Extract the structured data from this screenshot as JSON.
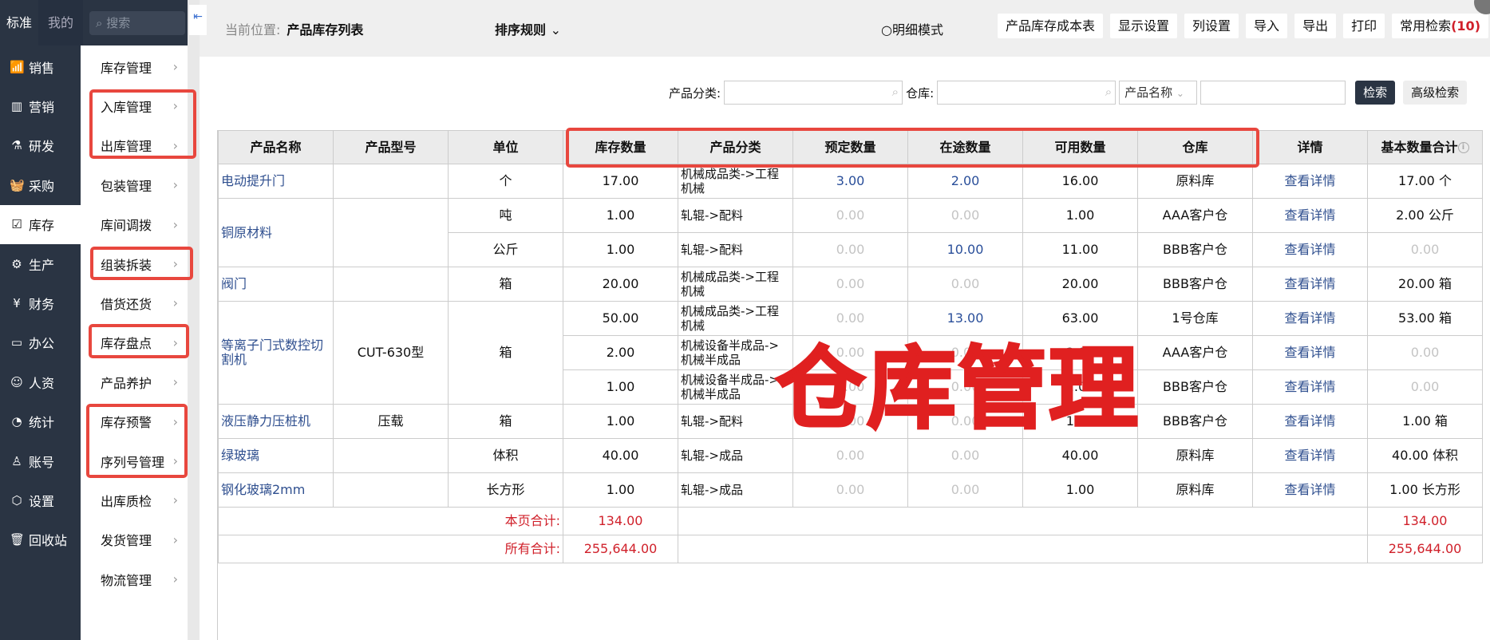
{
  "topnav": {
    "tab_standard": "标准",
    "tab_mine": "我的",
    "search_placeholder": "搜索"
  },
  "nav": [
    {
      "label": "销售",
      "icon": "chart-icon",
      "glyph": "📶"
    },
    {
      "label": "营销",
      "icon": "bar-chart-icon",
      "glyph": "▥"
    },
    {
      "label": "研发",
      "icon": "flask-icon",
      "glyph": "⚗"
    },
    {
      "label": "采购",
      "icon": "basket-icon",
      "glyph": "🧺"
    },
    {
      "label": "库存",
      "icon": "inventory-icon",
      "glyph": "☑",
      "active": true
    },
    {
      "label": "生产",
      "icon": "robot-arm-icon",
      "glyph": "⚙"
    },
    {
      "label": "财务",
      "icon": "yen-icon",
      "glyph": "¥"
    },
    {
      "label": "办公",
      "icon": "briefcase-icon",
      "glyph": "▭"
    },
    {
      "label": "人资",
      "icon": "person-card-icon",
      "glyph": "☺"
    },
    {
      "label": "统计",
      "icon": "pie-chart-icon",
      "glyph": "◔"
    },
    {
      "label": "账号",
      "icon": "user-icon",
      "glyph": "♙"
    },
    {
      "label": "设置",
      "icon": "settings-icon",
      "glyph": "⬡"
    },
    {
      "label": "回收站",
      "icon": "trash-icon",
      "glyph": "🗑"
    }
  ],
  "submenu": [
    "库存管理",
    "入库管理",
    "出库管理",
    "包装管理",
    "库间调拨",
    "组装拆装",
    "借货还货",
    "库存盘点",
    "产品养护",
    "库存预警",
    "序列号管理",
    "出库质检",
    "发货管理",
    "物流管理"
  ],
  "header": {
    "crumb_label": "当前位置:",
    "crumb_page": "产品库存列表",
    "sort": "排序规则",
    "detail_mode": "明细模式",
    "buttons": [
      "产品库存成本表",
      "显示设置",
      "列设置",
      "导入",
      "导出",
      "打印"
    ],
    "common_search": "常用检索",
    "common_search_count": "(10)"
  },
  "filters": {
    "category_label": "产品分类:",
    "warehouse_label": "仓库:",
    "field_select": "产品名称",
    "search": "检索",
    "advanced": "高级检索"
  },
  "table": {
    "headers": [
      "产品名称",
      "产品型号",
      "单位",
      "库存数量",
      "产品分类",
      "预定数量",
      "在途数量",
      "可用数量",
      "仓库",
      "详情",
      "基本数量合计"
    ],
    "rows": [
      {
        "name": "电动提升门",
        "model": "",
        "unit": "个",
        "items": [
          [
            "17.00",
            "机械成品类->工程机械",
            "3.00",
            "2.00",
            "16.00",
            "原料库",
            "查看详情",
            "17.00  个"
          ]
        ]
      },
      {
        "name": "铜原材料",
        "model": "",
        "units": [
          "吨",
          "公斤"
        ],
        "items": [
          [
            "1.00",
            "轧辊->配料",
            "0.00",
            "0.00",
            "1.00",
            "AAA客户仓",
            "查看详情",
            "2.00  公斤"
          ],
          [
            "1.00",
            "轧辊->配料",
            "0.00",
            "10.00",
            "11.00",
            "BBB客户仓",
            "查看详情",
            "0.00"
          ]
        ]
      },
      {
        "name": "阀门",
        "model": "",
        "unit": "箱",
        "items": [
          [
            "20.00",
            "机械成品类->工程机械",
            "0.00",
            "0.00",
            "20.00",
            "BBB客户仓",
            "查看详情",
            "20.00  箱"
          ]
        ]
      },
      {
        "name": "等离子门式数控切割机",
        "model": "CUT-630型",
        "unit": "箱",
        "items": [
          [
            "50.00",
            "机械成品类->工程机械",
            "0.00",
            "13.00",
            "63.00",
            "1号仓库",
            "查看详情",
            "53.00  箱"
          ],
          [
            "2.00",
            "机械设备半成品->机械半成品",
            "0.00",
            "0.00",
            "2.00",
            "AAA客户仓",
            "查看详情",
            "0.00"
          ],
          [
            "1.00",
            "机械设备半成品->机械半成品",
            "0.00",
            "0.00",
            "1.00",
            "BBB客户仓",
            "查看详情",
            "0.00"
          ]
        ]
      },
      {
        "name": "液压静力压桩机",
        "model": "压载",
        "unit": "箱",
        "items": [
          [
            "1.00",
            "轧辊->配料",
            "0.00",
            "0.00",
            "1.00",
            "BBB客户仓",
            "查看详情",
            "1.00  箱"
          ]
        ]
      },
      {
        "name": "绿玻璃",
        "model": "",
        "unit": "体积",
        "items": [
          [
            "40.00",
            "轧辊->成品",
            "0.00",
            "0.00",
            "40.00",
            "原料库",
            "查看详情",
            "40.00  体积"
          ]
        ]
      },
      {
        "name": "钢化玻璃2mm",
        "model": "",
        "unit": "长方形",
        "items": [
          [
            "1.00",
            "轧辊->成品",
            "0.00",
            "0.00",
            "1.00",
            "原料库",
            "查看详情",
            "1.00  长方形"
          ]
        ]
      }
    ],
    "page_total_label": "本页合计:",
    "page_total": "134.00",
    "page_total_base": "134.00",
    "all_total_label": "所有合计:",
    "all_total": "255,644.00",
    "all_total_base": "255,644.00"
  },
  "overlay_title": "仓库管理",
  "colors": {
    "sidebar": "#2a3443",
    "highlight": "#e8473e",
    "total": "#d0202a",
    "link": "#2f4f8f"
  }
}
